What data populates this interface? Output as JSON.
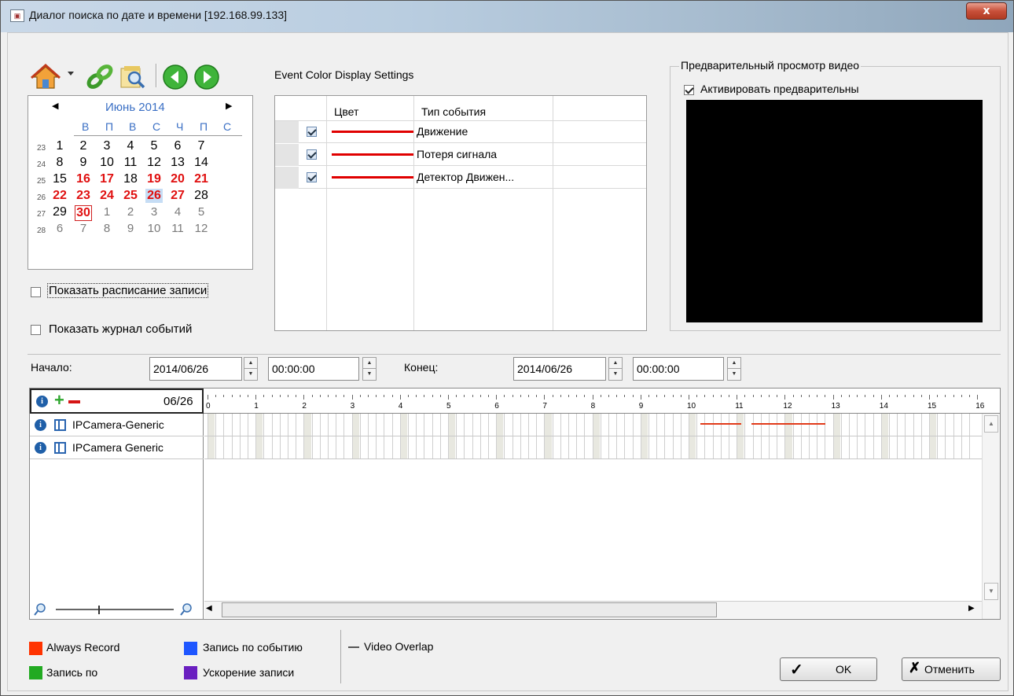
{
  "window": {
    "title": "Диалог поиска по дате и времени [192.168.99.133]",
    "close_glyph": "x"
  },
  "toolbar": {
    "icons": [
      "home-icon",
      "dropdown-arrow-icon",
      "link-icon",
      "search-folder-icon",
      "prev-icon",
      "next-icon"
    ]
  },
  "calendar": {
    "title": "Июнь 2014",
    "prev": "◀",
    "next": "▶",
    "dow": [
      "В",
      "П",
      "В",
      "С",
      "Ч",
      "П",
      "С"
    ],
    "weeks": [
      {
        "num": "23",
        "days": [
          [
            "1",
            ""
          ],
          [
            "2",
            ""
          ],
          [
            "3",
            ""
          ],
          [
            "4",
            ""
          ],
          [
            "5",
            ""
          ],
          [
            "6",
            ""
          ],
          [
            "7",
            ""
          ]
        ]
      },
      {
        "num": "24",
        "days": [
          [
            "8",
            ""
          ],
          [
            "9",
            ""
          ],
          [
            "10",
            ""
          ],
          [
            "11",
            ""
          ],
          [
            "12",
            ""
          ],
          [
            "13",
            ""
          ],
          [
            "14",
            ""
          ]
        ]
      },
      {
        "num": "25",
        "days": [
          [
            "15",
            ""
          ],
          [
            "16",
            "red"
          ],
          [
            "17",
            "red"
          ],
          [
            "18",
            ""
          ],
          [
            "19",
            "red"
          ],
          [
            "20",
            "red"
          ],
          [
            "21",
            "red"
          ]
        ]
      },
      {
        "num": "26",
        "days": [
          [
            "22",
            "red"
          ],
          [
            "23",
            "red"
          ],
          [
            "24",
            "red"
          ],
          [
            "25",
            "red"
          ],
          [
            "26",
            "red sel"
          ],
          [
            "27",
            "red"
          ],
          [
            "28",
            ""
          ]
        ]
      },
      {
        "num": "27",
        "days": [
          [
            "29",
            ""
          ],
          [
            "30",
            "red today"
          ],
          [
            "1",
            "grey"
          ],
          [
            "2",
            "grey"
          ],
          [
            "3",
            "grey"
          ],
          [
            "4",
            "grey"
          ],
          [
            "5",
            "grey"
          ]
        ]
      },
      {
        "num": "28",
        "days": [
          [
            "6",
            "grey"
          ],
          [
            "7",
            "grey"
          ],
          [
            "8",
            "grey"
          ],
          [
            "9",
            "grey"
          ],
          [
            "10",
            "grey"
          ],
          [
            "11",
            "grey"
          ],
          [
            "12",
            "grey"
          ]
        ]
      }
    ]
  },
  "options": {
    "show_schedule": "Показать расписание записи",
    "show_events": "Показать журнал событий"
  },
  "events": {
    "title": "Event Color Display Settings",
    "col_color": "Цвет",
    "col_type": "Тип события",
    "rows": [
      {
        "name": "Движение",
        "checked": true,
        "color": "#e00000"
      },
      {
        "name": "Потеря сигнала",
        "checked": true,
        "color": "#e00000"
      },
      {
        "name": "Детектор Движен...",
        "checked": true,
        "color": "#e00000"
      }
    ]
  },
  "preview": {
    "group_title": "Предварительный просмотр видео",
    "activate_label": "Активировать предварительны",
    "checked": true
  },
  "range": {
    "start_label": "Начало:",
    "start_date": "2014/06/26",
    "start_time": "00:00:00",
    "end_label": "Конец:",
    "end_date": "2014/06/26",
    "end_time": "00:00:00"
  },
  "timeline": {
    "date": "06/26",
    "hours": [
      "0",
      "1",
      "2",
      "3",
      "4",
      "5",
      "6",
      "7",
      "8",
      "9",
      "10",
      "11",
      "12",
      "13",
      "14",
      "15",
      "16"
    ],
    "cameras": [
      {
        "name": "IPCamera-Generic"
      },
      {
        "name": "IPCamera Generic"
      }
    ],
    "events_hours": [
      [
        10.25,
        11.1
      ],
      [
        11.3,
        12.85
      ]
    ]
  },
  "legend": {
    "always_record": {
      "label": "Always Record",
      "color": "#ff3300"
    },
    "record_by": {
      "label": "Запись по",
      "color": "#22aa22"
    },
    "record_event": {
      "label": "Запись по событию",
      "color": "#1e56ff"
    },
    "accel_record": {
      "label": "Ускорение записи",
      "color": "#6a1fc0"
    },
    "overlap": {
      "label": "Video Overlap"
    }
  },
  "buttons": {
    "ok": "OK",
    "cancel": "Отменить"
  }
}
